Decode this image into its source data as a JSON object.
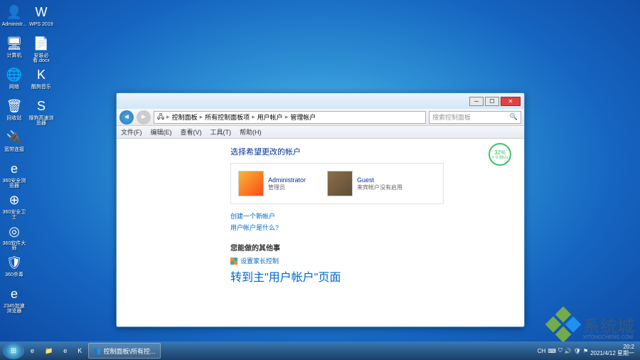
{
  "desktop": {
    "col1": [
      {
        "label": "Administr...",
        "icon": "👤"
      },
      {
        "label": "计算机",
        "icon": "🖥"
      },
      {
        "label": "网络",
        "icon": "🌐"
      },
      {
        "label": "回收站",
        "icon": "🗑"
      },
      {
        "label": "宽带连接",
        "icon": "🔌"
      },
      {
        "label": "360安全浏览器",
        "icon": "e"
      },
      {
        "label": "360安全卫士",
        "icon": "⊕"
      },
      {
        "label": "360软件大师",
        "icon": "◎"
      },
      {
        "label": "360杀毒",
        "icon": "🛡"
      },
      {
        "label": "2345加速浏览器",
        "icon": "e"
      }
    ],
    "col2": [
      {
        "label": "WPS 2019",
        "icon": "W"
      },
      {
        "label": "安装必看.docx",
        "icon": "📄"
      },
      {
        "label": "酷狗音乐",
        "icon": "K"
      },
      {
        "label": "搜狗高速浏览器",
        "icon": "S"
      }
    ]
  },
  "window": {
    "breadcrumb": [
      "控制面板",
      "所有控制面板项",
      "用户帐户",
      "管理帐户"
    ],
    "search_placeholder": "搜索控制面板",
    "menu": [
      "文件(F)",
      "编辑(E)",
      "查看(V)",
      "工具(T)",
      "帮助(H)"
    ],
    "title": "选择希望更改的帐户",
    "accounts": [
      {
        "name": "Administrator",
        "desc": "管理员"
      },
      {
        "name": "Guest",
        "desc": "来宾帐户没有启用"
      }
    ],
    "links": [
      "创建一个新帐户",
      "用户帐户是什么?"
    ],
    "other_title": "您能做的其他事",
    "other_links": [
      "设置家长控制",
      "转到主\"用户帐户\"页面"
    ],
    "speed": "32%",
    "speed_sub": "+ 0.6K/s"
  },
  "taskbar": {
    "task_label": "控制面板\\所有控...",
    "ime": "CH",
    "time": "20:2",
    "date": "2021/4/12 星期一"
  },
  "watermark": {
    "text": "系统城",
    "sub": "XITONGCHENG.COM"
  }
}
